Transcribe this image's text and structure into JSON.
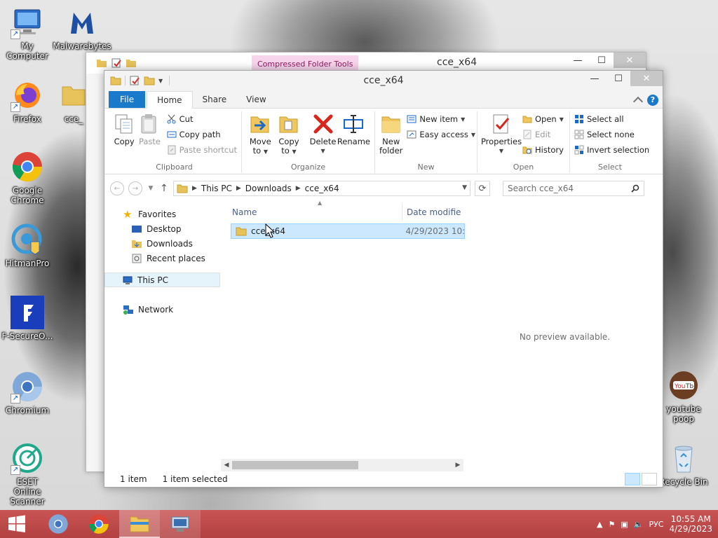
{
  "desktop": {
    "icons": [
      {
        "label": "My Computer",
        "icon": "computer-icon"
      },
      {
        "label": "Malwarebytes",
        "icon": "malwarebytes-icon"
      },
      {
        "label": "Firefox",
        "icon": "firefox-icon"
      },
      {
        "label": "cce_",
        "icon": "folder-icon"
      },
      {
        "label": "Google Chrome",
        "icon": "chrome-icon"
      },
      {
        "label": "HitmanPro",
        "icon": "hitmanpro-icon"
      },
      {
        "label": "F-SecureO...",
        "icon": "fsecure-icon"
      },
      {
        "label": "Chromium",
        "icon": "chromium-icon"
      },
      {
        "label": "ESET Online Scanner",
        "icon": "eset-icon"
      },
      {
        "label": "youtube poop",
        "icon": "youtube-icon"
      },
      {
        "label": "Recycle Bin",
        "icon": "recycle-bin-icon"
      }
    ]
  },
  "back_window": {
    "context_tab": "Compressed Folder Tools",
    "title": "cce_x64"
  },
  "window": {
    "title": "cce_x64",
    "caption": {
      "minimize": "—",
      "maximize": "☐",
      "close": "✕"
    }
  },
  "ribbon": {
    "tabs": [
      "File",
      "Home",
      "Share",
      "View"
    ],
    "active_tab": "Home",
    "help": "?",
    "groups": {
      "clipboard": {
        "name": "Clipboard",
        "copy": "Copy",
        "paste": "Paste",
        "cut": "Cut",
        "copy_path": "Copy path",
        "paste_shortcut": "Paste shortcut"
      },
      "organize": {
        "name": "Organize",
        "move_to_1": "Move",
        "move_to_2": "to",
        "copy_to_1": "Copy",
        "copy_to_2": "to",
        "delete": "Delete",
        "rename": "Rename"
      },
      "new": {
        "name": "New",
        "new_folder_1": "New",
        "new_folder_2": "folder",
        "new_item": "New item",
        "easy_access": "Easy access"
      },
      "open": {
        "name": "Open",
        "properties": "Properties",
        "open": "Open",
        "edit": "Edit",
        "history": "History"
      },
      "select": {
        "name": "Select",
        "select_all": "Select all",
        "select_none": "Select none",
        "invert": "Invert selection"
      }
    }
  },
  "address": {
    "crumbs": [
      "This PC",
      "Downloads",
      "cce_x64"
    ],
    "search_placeholder": "Search cce_x64"
  },
  "nav": {
    "favorites": "Favorites",
    "desktop": "Desktop",
    "downloads": "Downloads",
    "recent": "Recent places",
    "this_pc": "This PC",
    "network": "Network"
  },
  "files": {
    "col_name": "Name",
    "col_date": "Date modifie",
    "rows": [
      {
        "name": "cce_x64",
        "date": "4/29/2023 10:"
      }
    ]
  },
  "preview": {
    "text": "No preview available."
  },
  "status": {
    "count": "1 item",
    "selected": "1 item selected"
  },
  "taskbar": {
    "time": "10:55 AM",
    "date": "4/29/2023",
    "lang": "РУС"
  }
}
